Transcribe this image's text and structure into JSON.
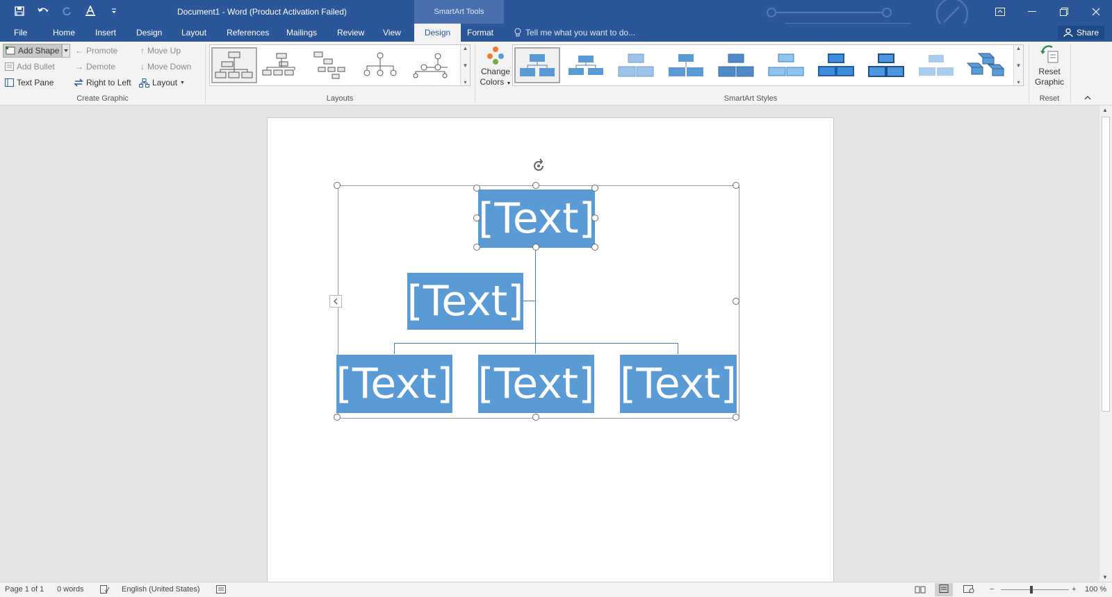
{
  "titlebar": {
    "title": "Document1 - Word (Product Activation Failed)",
    "contextual_tab_group": "SmartArt Tools",
    "quick_access": [
      "save-icon",
      "undo-icon",
      "redo-icon",
      "font-color-icon",
      "customize-icon"
    ],
    "window_controls": [
      "ribbon-display-icon",
      "minimize-icon",
      "restore-icon",
      "close-icon"
    ]
  },
  "tabs": [
    "File",
    "Home",
    "Insert",
    "Design",
    "Layout",
    "References",
    "Mailings",
    "Review",
    "View",
    "Design",
    "Format"
  ],
  "active_tab_index": 9,
  "tell_me": "Tell me what you want to do...",
  "share": "Share",
  "ribbon": {
    "create_graphic": {
      "label": "Create Graphic",
      "add_shape": "Add Shape",
      "add_bullet": "Add Bullet",
      "text_pane": "Text Pane",
      "promote": "Promote",
      "demote": "Demote",
      "right_to_left": "Right to Left",
      "move_up": "Move Up",
      "move_down": "Move Down",
      "layout": "Layout"
    },
    "layouts": {
      "label": "Layouts"
    },
    "change_colors": {
      "line1": "Change",
      "line2": "Colors"
    },
    "smartart_styles": {
      "label": "SmartArt Styles"
    },
    "reset": {
      "label": "Reset",
      "line1": "Reset",
      "line2": "Graphic"
    }
  },
  "smartart": {
    "top_node": "[Text]",
    "assistant_node": "[Text]",
    "child_nodes": [
      "[Text]",
      "[Text]",
      "[Text]"
    ],
    "fill_color": "#5b9bd5",
    "connector_color": "#4a7ebb"
  },
  "statusbar": {
    "page": "Page 1 of 1",
    "words": "0 words",
    "language": "English (United States)",
    "zoom": "100 %"
  },
  "colors": {
    "word_blue": "#2b579a",
    "ribbon_bg": "#f3f3f3"
  }
}
